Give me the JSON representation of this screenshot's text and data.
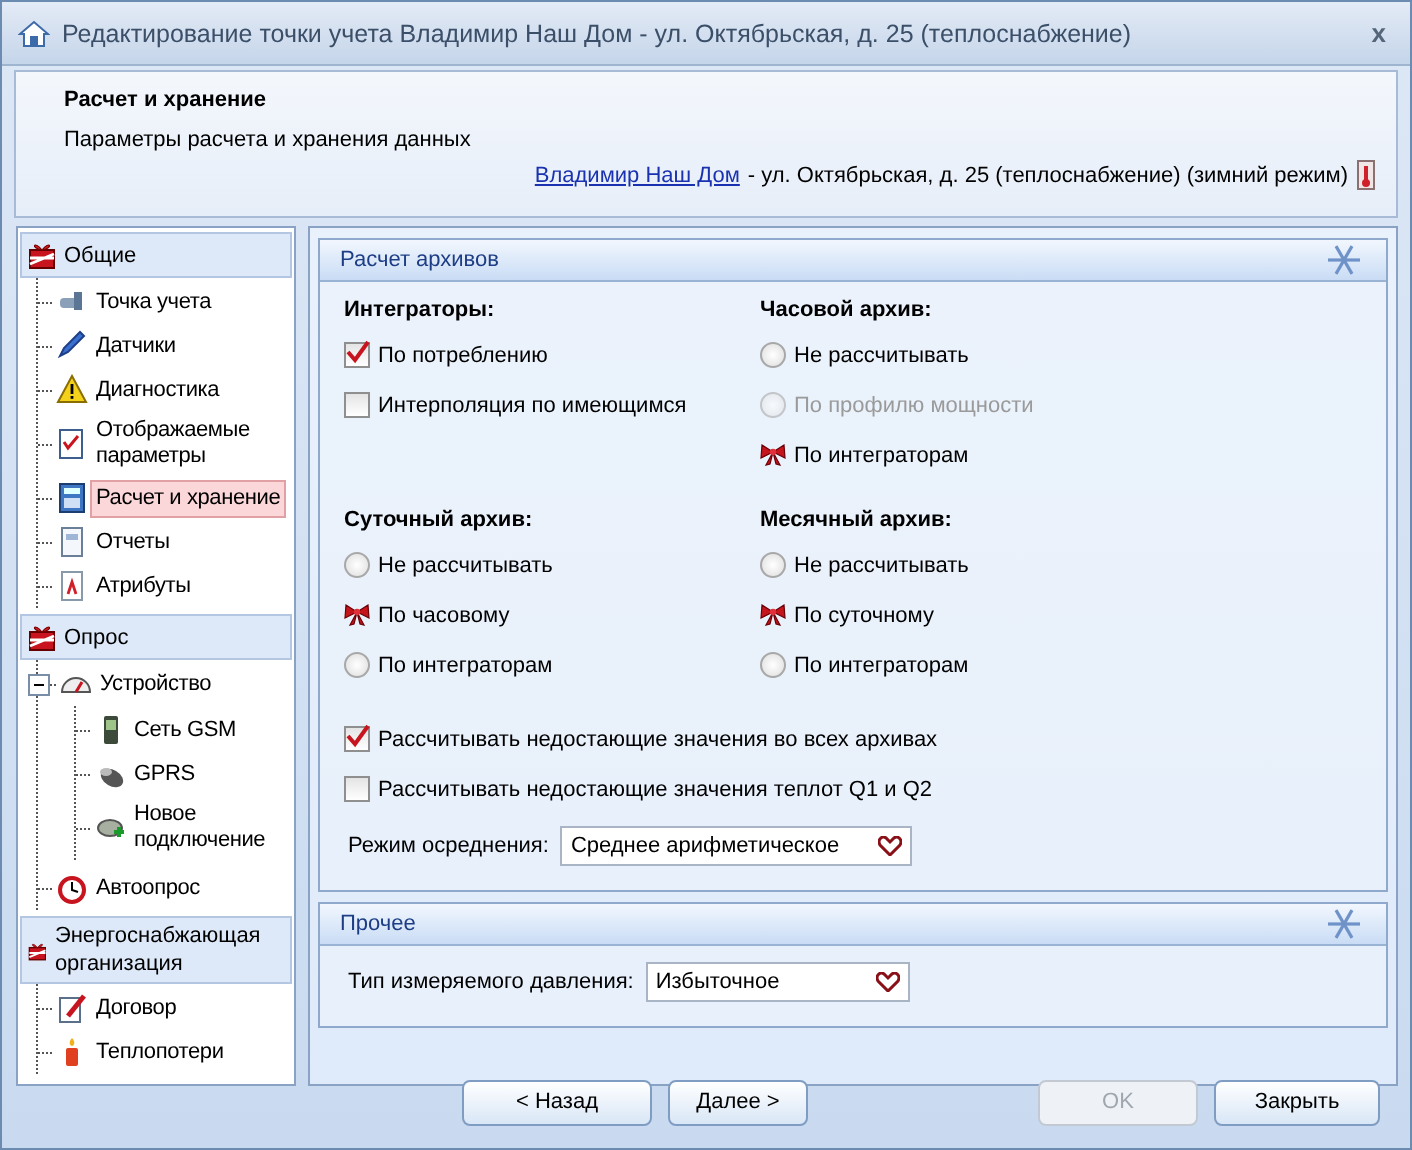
{
  "window": {
    "title": "Редактирование точки учета Владимир Наш Дом - ул. Октябрьская, д. 25 (теплоснабжение)",
    "close": "x"
  },
  "header": {
    "title": "Расчет и хранение",
    "subtitle": "Параметры расчета и хранения данных",
    "location_link": "Владимир Наш Дом",
    "location_text": "- ул. Октябрьская, д. 25 (теплоснабжение) (зимний режим)"
  },
  "sidebar": {
    "groups": [
      {
        "label": "Общие",
        "items": [
          {
            "label": "Точка учета",
            "selected": false
          },
          {
            "label": "Датчики",
            "selected": false
          },
          {
            "label": "Диагностика",
            "selected": false
          },
          {
            "label": "Отображаемые параметры",
            "selected": false
          },
          {
            "label": "Расчет и хранение",
            "selected": true
          },
          {
            "label": "Отчеты",
            "selected": false
          },
          {
            "label": "Атрибуты",
            "selected": false
          }
        ]
      },
      {
        "label": "Опрос",
        "items": [
          {
            "label": "Устройство",
            "selected": false,
            "expanded": true,
            "children": [
              {
                "label": "Сеть GSM",
                "selected": false
              },
              {
                "label": "GPRS",
                "selected": false
              },
              {
                "label": "Новое подключение",
                "selected": false
              }
            ]
          },
          {
            "label": "Автоопрос",
            "selected": false
          }
        ]
      },
      {
        "label": "Энергоснабжающая организация",
        "items": [
          {
            "label": "Договор",
            "selected": false
          },
          {
            "label": "Теплопотери",
            "selected": false
          }
        ]
      }
    ]
  },
  "archives": {
    "title": "Расчет архивов",
    "sections": [
      {
        "title": "Интеграторы:",
        "kind": "checkbox",
        "options": [
          {
            "label": "По потреблению",
            "checked": true
          },
          {
            "label": "Интерполяция по имеющимся",
            "checked": false
          }
        ]
      },
      {
        "title": "Часовой архив:",
        "kind": "radio",
        "options": [
          {
            "label": "Не рассчитывать",
            "selected": false,
            "disabled": false
          },
          {
            "label": "По профилю мощности",
            "selected": false,
            "disabled": true
          },
          {
            "label": "По интеграторам",
            "selected": true,
            "disabled": false
          }
        ]
      },
      {
        "title": "Суточный архив:",
        "kind": "radio",
        "options": [
          {
            "label": "Не рассчитывать",
            "selected": false,
            "disabled": false
          },
          {
            "label": "По часовому",
            "selected": true,
            "disabled": false
          },
          {
            "label": "По интеграторам",
            "selected": false,
            "disabled": false
          }
        ]
      },
      {
        "title": "Месячный архив:",
        "kind": "radio",
        "options": [
          {
            "label": "Не рассчитывать",
            "selected": false,
            "disabled": false
          },
          {
            "label": "По суточному",
            "selected": true,
            "disabled": false
          },
          {
            "label": "По интеграторам",
            "selected": false,
            "disabled": false
          }
        ]
      }
    ],
    "extra_options": [
      {
        "label": "Рассчитывать недостающие значения во всех архивах",
        "checked": true
      },
      {
        "label": "Рассчитывать недостающие значения теплот Q1 и Q2",
        "checked": false
      }
    ],
    "averaging": {
      "label": "Режим осреднения:",
      "value": "Среднее арифметическое"
    }
  },
  "other": {
    "title": "Прочее",
    "pressure": {
      "label": "Тип измеряемого давления:",
      "value": "Избыточное"
    }
  },
  "buttons": [
    {
      "label": "< Назад",
      "disabled": false
    },
    {
      "label": "Далее >",
      "disabled": false
    },
    {
      "label": "OK",
      "disabled": true
    },
    {
      "label": "Закрыть",
      "disabled": false
    }
  ]
}
